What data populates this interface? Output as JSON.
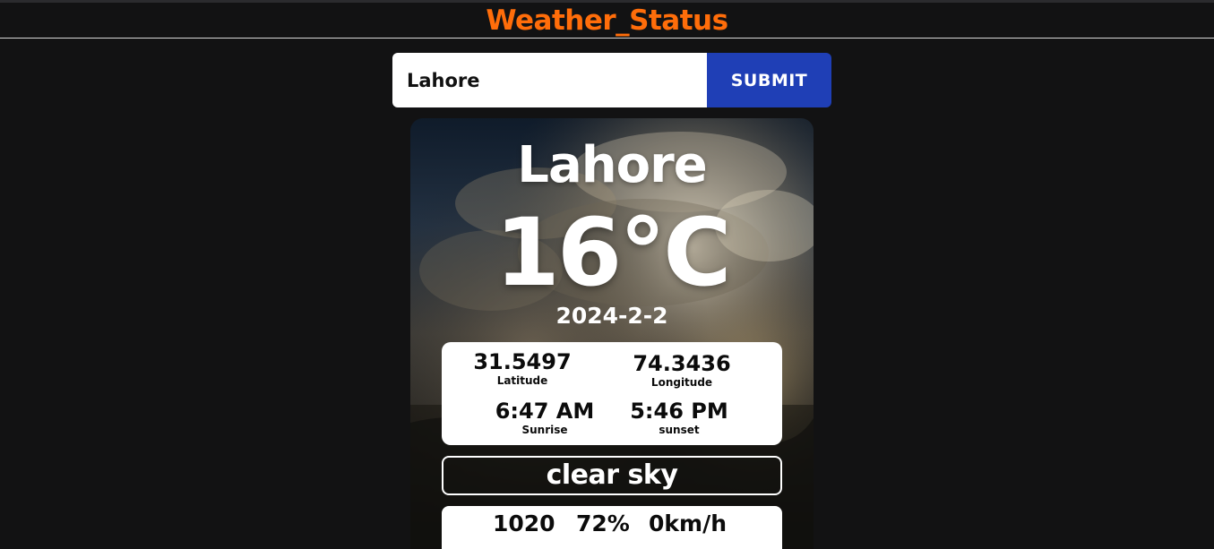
{
  "app": {
    "title": "Weather_Status"
  },
  "search": {
    "value": "Lahore",
    "submit_label": "SUBMIT"
  },
  "weather": {
    "city": "Lahore",
    "temperature": "16°C",
    "date": "2024-2-2",
    "latitude": {
      "value": "31.5497",
      "label": "Latitude"
    },
    "longitude": {
      "value": "74.3436",
      "label": "Longitude"
    },
    "sunrise": {
      "value": "6:47 AM",
      "label": "Sunrise"
    },
    "sunset": {
      "value": "5:46 PM",
      "label": "sunset"
    },
    "condition": "clear sky",
    "pressure": "1020",
    "humidity": "72%",
    "wind": "0km/h"
  },
  "colors": {
    "brand": "#ff6d0a",
    "submit": "#1f3fb6",
    "background": "#121213"
  }
}
